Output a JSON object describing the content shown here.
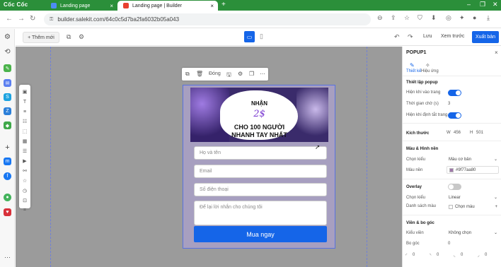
{
  "browser": {
    "brand": "Cốc Cốc",
    "tabs": [
      {
        "label": "Landing page",
        "active": false
      },
      {
        "label": "Landing page | Builder",
        "active": true
      }
    ],
    "url": "builder.salekit.com/64c0c5d7ba2fa6032b05a043"
  },
  "toolbar": {
    "add_label": "+ Thêm mới",
    "save_label": "Lưu",
    "preview_label": "Xem trước",
    "publish_label": "Xuất bản"
  },
  "popup_toolbar": {
    "close_label": "Đóng"
  },
  "popup": {
    "banner": {
      "line1": "NHẬN",
      "line2": "2$",
      "line3": "CHO 100 NGƯỜI",
      "line4": "NHANH TAY NHẤT"
    },
    "fields": {
      "name_placeholder": "Họ và tên",
      "email_placeholder": "Email",
      "phone_placeholder": "Số điện thoại",
      "message_placeholder": "Để lại lời nhắn cho chúng tôi"
    },
    "submit_label": "Mua ngay"
  },
  "right_panel": {
    "title": "POPUP1",
    "tab_design": "Thiết kế",
    "tab_effect": "Hiệu ứng",
    "section_settings": "Thiết lập popup",
    "show_on_load": "Hiện khi vào trang",
    "delay_label": "Thời gian chờ (s)",
    "delay_value": "3",
    "show_on_exit": "Hiện khi định tắt trang",
    "section_size": "Kích thước",
    "width_label": "W",
    "width_value": "456",
    "height_label": "H",
    "height_value": "501",
    "section_color": "Màu & Hình nền",
    "choose_type_label": "Chọn kiểu",
    "choose_type_value": "Màu cơ bản",
    "bg_color_label": "Màu nền",
    "bg_color_value": "#9f77aa80",
    "section_overlay": "Overlay",
    "overlay_type_label": "Chọn kiểu",
    "overlay_type_value": "Linear",
    "color_list_label": "Danh sách màu",
    "color_list_value": "Chọn màu",
    "section_border": "Viền & bo góc",
    "border_style_label": "Kiểu viền",
    "border_style_value": "Không chọn",
    "radius_label": "Bo góc",
    "radius_value": "0",
    "corner_values": [
      "0",
      "0",
      "0",
      "0"
    ]
  },
  "colors": {
    "tabbar": "#2b8f3a",
    "accent": "#1565e8",
    "canvas": "#9b9b9b",
    "popup_bg": "#a79fc0"
  }
}
